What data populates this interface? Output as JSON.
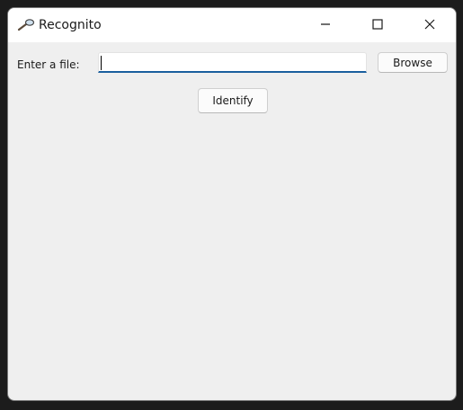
{
  "window": {
    "title": "Recognito",
    "icon": "magnifier-icon",
    "controls": [
      "minimize-icon",
      "maximize-icon",
      "close-icon"
    ]
  },
  "form": {
    "file_label": "Enter a file:",
    "file_value": "",
    "browse_label": "Browse",
    "identify_label": "Identify"
  },
  "colors": {
    "input_focus_underline": "#1a5f9e",
    "window_background": "#efefef",
    "titlebar_background": "#ffffff"
  }
}
